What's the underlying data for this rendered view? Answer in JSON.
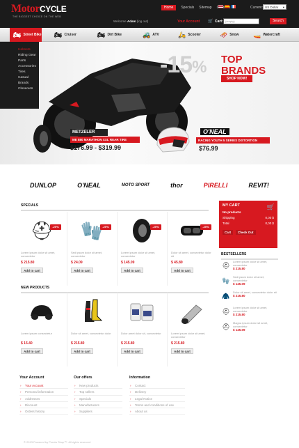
{
  "header": {
    "logo_main": "Motor",
    "logo_sub": "CYCLE",
    "tagline": "THE BIGGEST CHOICE ON THE WEB",
    "nav": [
      "Home",
      "Specials",
      "Sitemap",
      "Contacts"
    ],
    "currencies_label": "Currencies:",
    "currency_selected": "US Dollar",
    "welcome_prefix": "Welcome",
    "welcome_user": "Adam",
    "logout": "(log out)",
    "your_account": "Your Account",
    "cart_label": "Cart:",
    "cart_value": "(empty)",
    "search_button": "Search"
  },
  "categories": [
    {
      "label": "Street Bike",
      "icon": "sport-bike-icon",
      "active": true
    },
    {
      "label": "Cruiser",
      "icon": "cruiser-icon",
      "active": false
    },
    {
      "label": "Dirt Bike",
      "icon": "dirt-bike-icon",
      "active": false
    },
    {
      "label": "ATV",
      "icon": "atv-icon",
      "active": false
    },
    {
      "label": "Scooter",
      "icon": "scooter-icon",
      "active": false
    },
    {
      "label": "Snow",
      "icon": "snowmobile-icon",
      "active": false
    },
    {
      "label": "Watercraft",
      "icon": "watercraft-icon",
      "active": false
    }
  ],
  "side_menu": [
    "Helmets",
    "Riding Gear",
    "Parts",
    "Accessories",
    "Tires",
    "Casual",
    "Brands",
    "Closeouts"
  ],
  "banner": {
    "discount": "-15",
    "discount_sign": "%",
    "headline_1": "TOP",
    "headline_2": "BRANDS",
    "cta": "SHOP NOW!",
    "promo1": {
      "brand": "METZELER",
      "title": "ME 880 MARATHON XXL REAR TIRE",
      "price": "$176.99 - $319.99"
    },
    "promo2": {
      "brand": "O'NEAL",
      "title": "RACING YOUTH 5 SERIES DISTORTION HELMET",
      "price": "$76.99"
    }
  },
  "brands": [
    "DUNLOP",
    "O'NEAL",
    "MOTO SPORT",
    "thor",
    "PIRELLI",
    "REVIT!"
  ],
  "specials": {
    "title": "SPECIALS",
    "items": [
      {
        "desc": "Lorem ipsum dolor sit amet, consectetur",
        "price": "$ 215.80",
        "badge": "-20%",
        "icon": "helmet-icon"
      },
      {
        "desc": "Sed ipsum dolor sit amet, consectetur",
        "price": "$ 24.09",
        "badge": "-20%",
        "icon": "glove-icon"
      },
      {
        "desc": "Lorem ipsum dolor sit amet, consectetur",
        "price": "$ 145.09",
        "badge": "-20%",
        "icon": "tire-icon"
      },
      {
        "desc": "Dolor sit amet, consectetur dolor sit",
        "price": "$ 45.89",
        "badge": "-20%",
        "icon": "goggles-icon"
      }
    ],
    "add_to_cart": "Add to cart"
  },
  "new_products": {
    "title": "NEW PRODUCTS",
    "items": [
      {
        "desc": "Lorem ipsum consectetur",
        "price": "$ 15.40",
        "icon": "bike-cover-icon"
      },
      {
        "desc": "Dolor sit amet, consectetur dolor",
        "price": "$ 215.80",
        "icon": "boots-icon"
      },
      {
        "desc": "Dolor amet dolor sit, consectetur",
        "price": "$ 215.80",
        "icon": "oil-can-icon"
      },
      {
        "desc": "Lorem ipsum dolor sit amet, consectetur",
        "price": "$ 215.80",
        "icon": "exhaust-icon"
      }
    ],
    "add_to_cart": "Add to cart"
  },
  "cart_panel": {
    "title": "MY CART",
    "subtitle": "No products",
    "lines": [
      {
        "label": "Shipping",
        "value": "0,00 $"
      },
      {
        "label": "Total",
        "value": "0,00 $"
      }
    ],
    "buttons": [
      "Cart",
      "Check Out"
    ]
  },
  "bestsellers": {
    "title": "BESTSELLERS",
    "items": [
      {
        "desc": "Lorem ipsum dolor sit amet, consectetur",
        "price": "$ 215.80",
        "icon": "helmet-icon"
      },
      {
        "desc": "Sed ipsum dolor sit amet, consectetur",
        "price": "$ 145.09",
        "icon": "glove-icon"
      },
      {
        "desc": "Dolor sit amet, consectetur dolor sit",
        "price": "$ 215.80",
        "icon": "jacket-icon"
      },
      {
        "desc": "Lorem ipsum dolor sit amet, consectetur",
        "price": "$ 215.80",
        "icon": "helmet-icon"
      },
      {
        "desc": "Magna ipsum dolor sit amet, consectetur",
        "price": "$ 145.09",
        "icon": "helmet-icon"
      }
    ]
  },
  "footer": {
    "columns": [
      {
        "title": "Your Account",
        "links": [
          "Your Account",
          "Personal information",
          "Addresses",
          "Discount",
          "Orders history"
        ]
      },
      {
        "title": "Our offers",
        "links": [
          "New products",
          "Top sellers",
          "Specials",
          "Manufacturers",
          "Suppliers"
        ]
      },
      {
        "title": "Information",
        "links": [
          "Contact",
          "Delivery",
          "Legal Notice",
          "Terms and conditions of use",
          "About us"
        ]
      }
    ],
    "copyright": "© 2013 Powered by Presta Shop™. All rights reserved"
  },
  "colors": {
    "accent": "#d71920",
    "header_bg": "#1b1b1b"
  }
}
